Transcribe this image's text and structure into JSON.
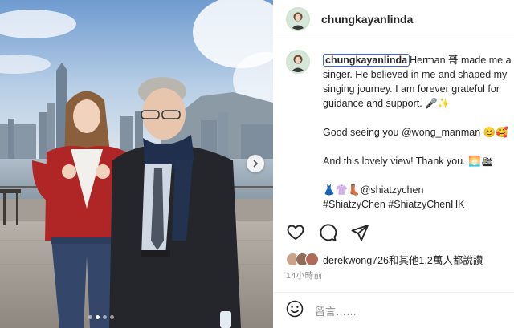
{
  "post": {
    "username": "chungkayanlinda"
  },
  "caption": {
    "username": "chungkayanlinda",
    "line1_rest": "Herman 哥 made me a",
    "line2": "singer. He believed in me and shaped my",
    "line3": "singing journey. I am forever grateful for",
    "line4": "guidance and support. 🎤✨",
    "line5": "Good seeing you @wong_manman 😊🥰",
    "line6": "And this lovely view! Thank you. 🌅🛳",
    "line7": "👗👚👢@shiatzychen",
    "line8": "#ShiatzyChen #ShiatzyChenHK"
  },
  "likes": {
    "text": "derekwong726和其他1.2萬人都說讚"
  },
  "time": "14小時前",
  "add_comment": {
    "placeholder": "留言……"
  },
  "colors": {
    "sky": "#8fb2d8",
    "tag_outline": "#3b6fd4",
    "secondary_text": "#8e8e8e"
  },
  "icons": [
    "heart-icon",
    "comment-icon",
    "share-icon",
    "emoji-icon",
    "chevron-right-icon"
  ],
  "carousel": {
    "slides": 4,
    "active": 1
  }
}
